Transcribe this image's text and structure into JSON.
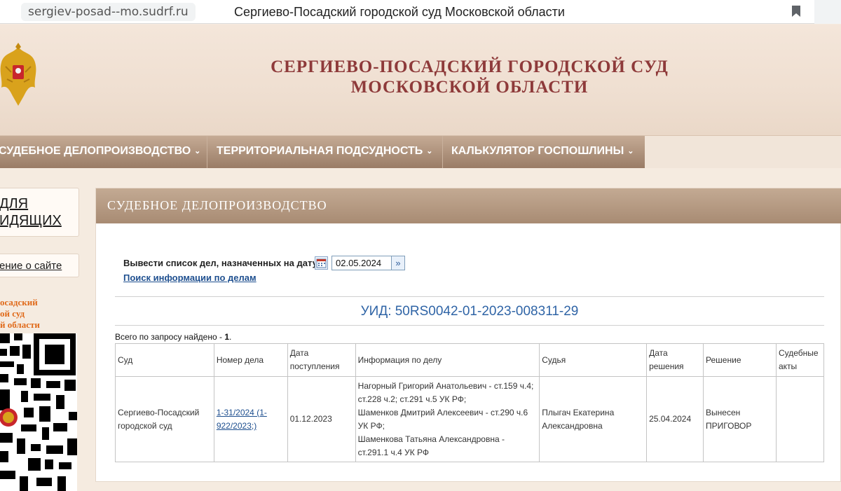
{
  "browser": {
    "url": "sergiev-posad--mo.sudrf.ru",
    "tab_title": "Сергиево-Посадский городской суд Московской области"
  },
  "header": {
    "title_line1": "СЕРГИЕВО-ПОСАДСКИЙ ГОРОДСКОЙ СУД",
    "title_line2": "МОСКОВСКОЙ ОБЛАСТИ"
  },
  "nav": {
    "items": [
      {
        "label": "СУДЕБНОЕ ДЕЛОПРОИЗВОДСТВО"
      },
      {
        "label": "ТЕРРИТОРИАЛЬНАЯ ПОДСУДНОСТЬ"
      },
      {
        "label": "КАЛЬКУЛЯТОР ГОСПОШЛИНЫ"
      }
    ]
  },
  "sidebar": {
    "accessibility_line1": "ДЛЯ",
    "accessibility_line2": "ИДЯЩИХ",
    "about_link": "ение о сайте",
    "court_name_line1": "осадский",
    "court_name_line2": "ой суд",
    "court_name_line3": "й области"
  },
  "content": {
    "panel_title": "СУДЕБНОЕ ДЕЛОПРОИЗВОДСТВО",
    "date_label": "Вывести список дел, назначенных на дату",
    "date_value": "02.05.2024",
    "search_link": "Поиск информации по делам",
    "uid": "УИД: 50RS0042-01-2023-008311-29",
    "found_prefix": "Всего по запросу найдено - ",
    "found_count": "1",
    "found_suffix": ".",
    "table": {
      "headers": {
        "court": "Суд",
        "case_number": "Номер дела",
        "received_line1": "Дата",
        "received_line2": "поступления",
        "info": "Информация по делу",
        "judge": "Судья",
        "decision_date_line1": "Дата",
        "decision_date_line2": "решения",
        "decision": "Решение",
        "acts_line1": "Судебные",
        "acts_line2": "акты"
      },
      "rows": [
        {
          "court": "Сергиево-Посадский городской суд",
          "case_number": "1-31/2024 (1-922/2023;)",
          "received": "01.12.2023",
          "info_1": "Нагорный Григорий Анатольевич - ст.159 ч.4; ст.228 ч.2; ст.291 ч.5 УК РФ;",
          "info_2": "Шаменков Дмитрий Алексеевич - ст.290 ч.6 УК РФ;",
          "info_3": "Шаменкова Татьяна Александровна - ст.291.1 ч.4 УК РФ",
          "judge": "Плыгач Екатерина Александровна",
          "decision_date": "25.04.2024",
          "decision_line1": "Вынесен",
          "decision_line2": "ПРИГОВОР",
          "acts": ""
        }
      ]
    }
  },
  "colors": {
    "title_red": "#8e3a3a",
    "link_blue": "#1e4f8f",
    "uid_blue": "#2f64a6",
    "nav_brown": "#a88b73",
    "sidebar_orange": "#e06a1a"
  }
}
